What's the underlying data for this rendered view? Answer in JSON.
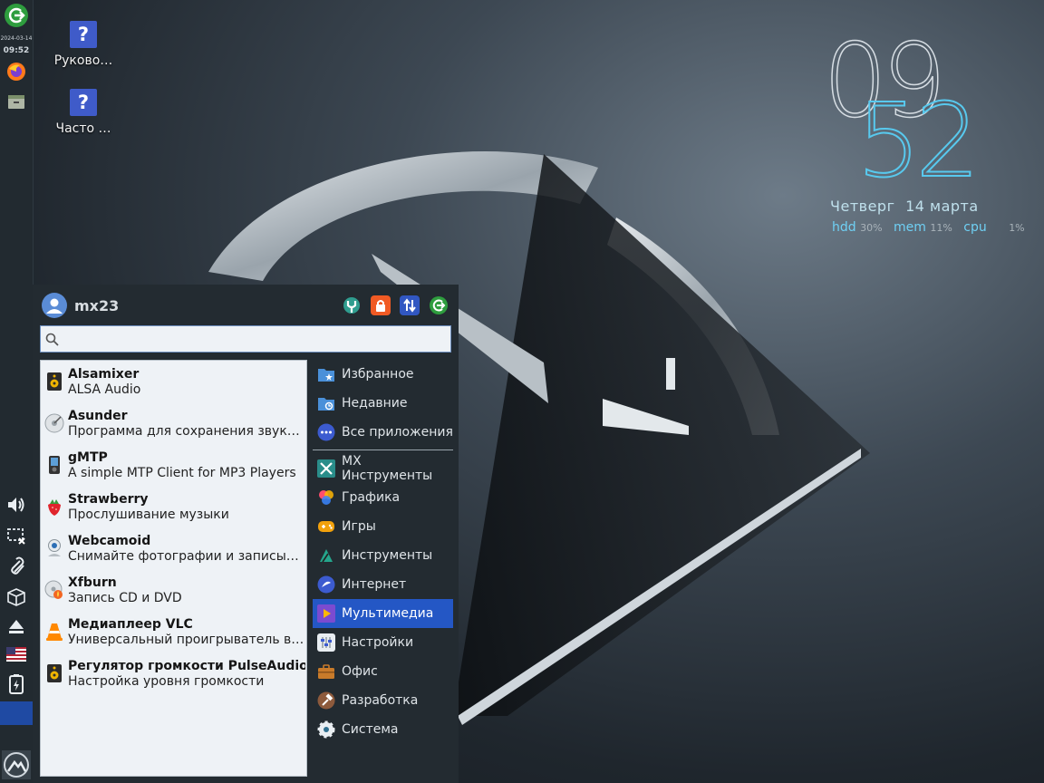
{
  "panel": {
    "date": "2024-03-14",
    "time": "09:52",
    "icons": [
      "logout-icon",
      "firefox-icon",
      "file-manager-icon",
      "volume-icon",
      "network-disconnected-icon",
      "clipman-icon",
      "package-updater-icon",
      "eject-icon",
      "keyboard-layout-us-icon",
      "battery-charging-icon",
      "mx-menu-icon"
    ]
  },
  "desktop": {
    "icons": [
      {
        "label": "Руково…"
      },
      {
        "label": "Часто …"
      }
    ]
  },
  "conky": {
    "hour": "09",
    "minute": "52",
    "weekday": "Четверг",
    "date": "14 марта",
    "hdd_label": "hdd",
    "hdd_value": "30%",
    "mem_label": "mem",
    "mem_value": "11%",
    "cpu_label": "cpu",
    "cpu_value": "1%"
  },
  "menu": {
    "user": "mx23",
    "actions": [
      "settings-manager-icon",
      "lock-screen-icon",
      "switch-user-icon",
      "logout-icon"
    ],
    "search": {
      "value": "",
      "placeholder": ""
    },
    "apps": [
      {
        "name": "Alsamixer",
        "desc": "ALSA Audio"
      },
      {
        "name": "Asunder",
        "desc": "Программа для сохранения звуковых дорожек"
      },
      {
        "name": "gMTP",
        "desc": "A simple MTP Client for MP3 Players"
      },
      {
        "name": "Strawberry",
        "desc": "Прослушивание музыки"
      },
      {
        "name": "Webcamoid",
        "desc": "Снимайте фотографии и записывайте видео"
      },
      {
        "name": "Xfburn",
        "desc": "Запись CD и DVD"
      },
      {
        "name": "Медиаплеер VLC",
        "desc": "Универсальный проигрыватель видео и аудио"
      },
      {
        "name": "Регулятор громкости PulseAudio",
        "desc": "Настройка уровня громкости"
      }
    ],
    "categories_top": [
      "Избранное",
      "Недавние",
      "Все приложения"
    ],
    "categories": [
      "MX Инструменты",
      "Графика",
      "Игры",
      "Инструменты",
      "Интернет",
      "Мультимедиа",
      "Настройки",
      "Офис",
      "Разработка",
      "Система"
    ],
    "active_category": "Мультимедиа"
  },
  "colors": {
    "accent": "#2457c5",
    "clock_minute": "#58c9ee",
    "panel_bg": "#222a30"
  }
}
